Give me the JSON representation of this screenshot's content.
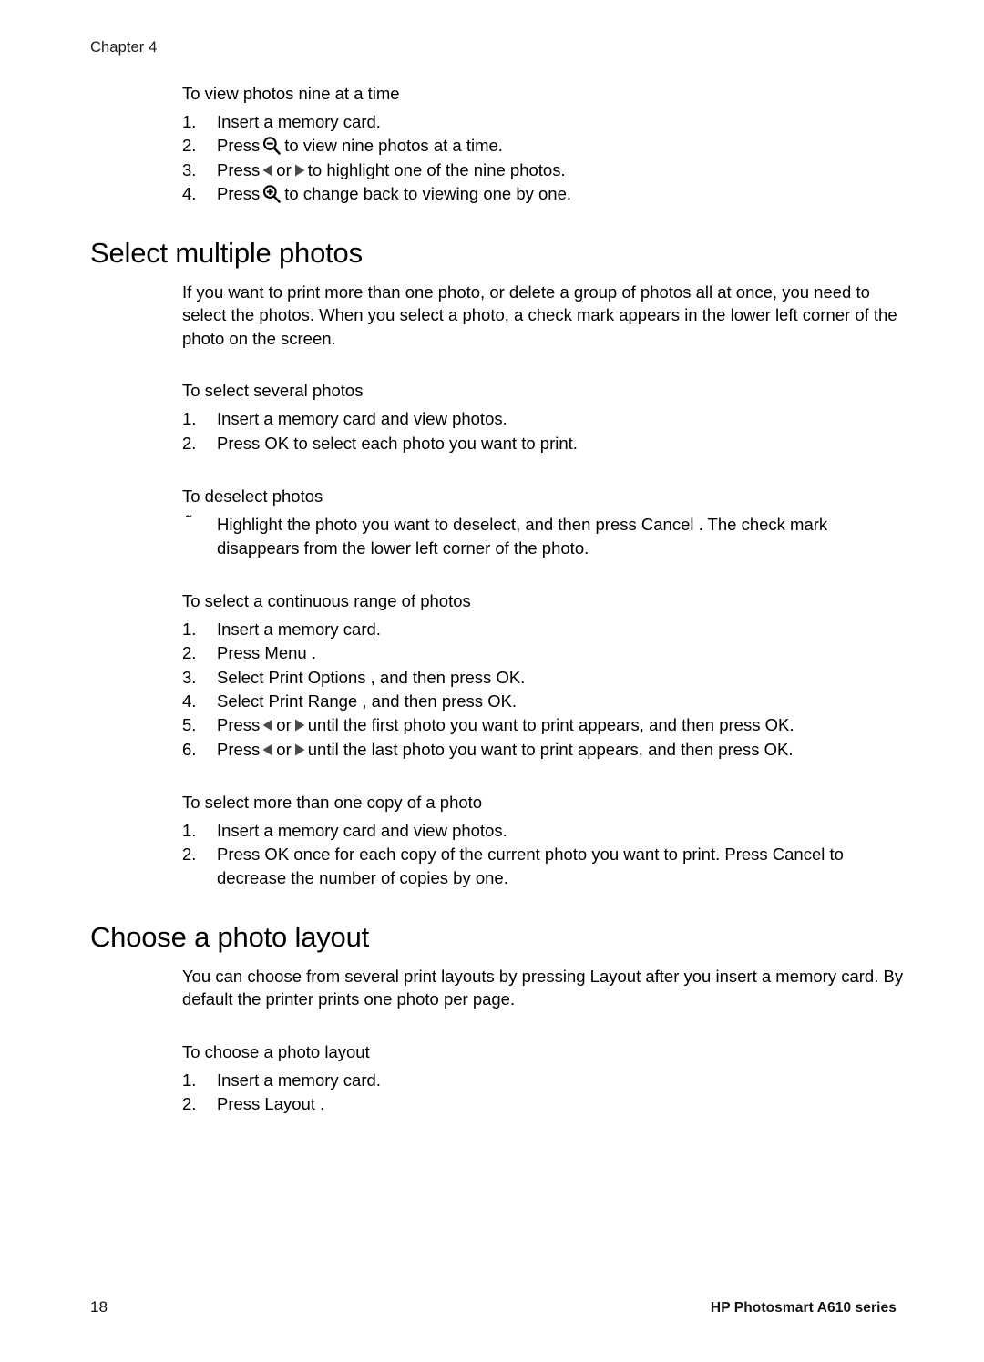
{
  "header": {
    "chapter": "Chapter 4"
  },
  "body": {
    "blocks": [
      {
        "kind": "procedure",
        "title": "To view photos nine at a time",
        "steps": [
          {
            "marker": "1.",
            "text": "Insert a memory card."
          },
          {
            "marker": "2.",
            "pre": "Press",
            "icon": "magnifier-minus-icon",
            "post": "to view nine photos at a time."
          },
          {
            "marker": "3.",
            "pre": "Press",
            "icon": "arrow-left-icon",
            "mid": "or",
            "icon2": "arrow-right-icon",
            "post": "to highlight one of the nine photos."
          },
          {
            "marker": "4.",
            "pre": "Press",
            "icon": "magnifier-plus-icon",
            "post": "to change back to viewing one by one."
          }
        ]
      },
      {
        "kind": "heading",
        "text": "Select multiple photos"
      },
      {
        "kind": "paragraph",
        "text": "If you want to print more than one photo, or delete a group of photos all at once, you need to select the photos. When you select a photo, a check mark appears in the lower left corner of the photo on the screen."
      },
      {
        "kind": "procedure",
        "title": "To select several photos",
        "steps": [
          {
            "marker": "1.",
            "text": "Insert a memory card and view photos."
          },
          {
            "marker": "2.",
            "text": "Press OK to select each photo you want to print."
          }
        ]
      },
      {
        "kind": "procedure",
        "title": "To deselect photos",
        "steps": [
          {
            "marker": "˜",
            "text": "Highlight the photo you want to deselect, and then press Cancel . The check mark disappears from the lower left corner of the photo."
          }
        ]
      },
      {
        "kind": "procedure",
        "title": "To select a continuous range of photos",
        "steps": [
          {
            "marker": "1.",
            "text": "Insert a memory card."
          },
          {
            "marker": "2.",
            "text": "Press Menu ."
          },
          {
            "marker": "3.",
            "text": "Select Print Options  , and then press OK."
          },
          {
            "marker": "4.",
            "text": "Select Print Range , and then press OK."
          },
          {
            "marker": "5.",
            "pre": "Press",
            "icon": "arrow-left-icon",
            "mid": "or",
            "icon2": "arrow-right-icon",
            "post": "until the first photo you want to print appears, and then press OK."
          },
          {
            "marker": "6.",
            "pre": "Press",
            "icon": "arrow-left-icon",
            "mid": "or",
            "icon2": "arrow-right-icon",
            "post": "until the last photo you want to print appears, and then press OK."
          }
        ]
      },
      {
        "kind": "procedure",
        "title": "To select more than one copy of a photo",
        "steps": [
          {
            "marker": "1.",
            "text": "Insert a memory card and view photos."
          },
          {
            "marker": "2.",
            "text": "Press OK once for each copy of the current photo you want to print. Press Cancel to decrease the number of copies by one."
          }
        ]
      },
      {
        "kind": "heading",
        "text": "Choose a photo layout"
      },
      {
        "kind": "paragraph",
        "text": "You can choose from several print layouts by pressing Layout  after you insert a memory card. By default the printer prints one photo per page."
      },
      {
        "kind": "procedure",
        "title": "To choose a photo layout",
        "steps": [
          {
            "marker": "1.",
            "text": "Insert a memory card."
          },
          {
            "marker": "2.",
            "text": "Press Layout ."
          }
        ]
      }
    ]
  },
  "footer": {
    "page_number": "18",
    "product": "HP Photosmart A610 series"
  },
  "colors": {
    "text": "#000000",
    "arrow_glyph": "#4a4a4a",
    "page_background": "#ffffff"
  }
}
